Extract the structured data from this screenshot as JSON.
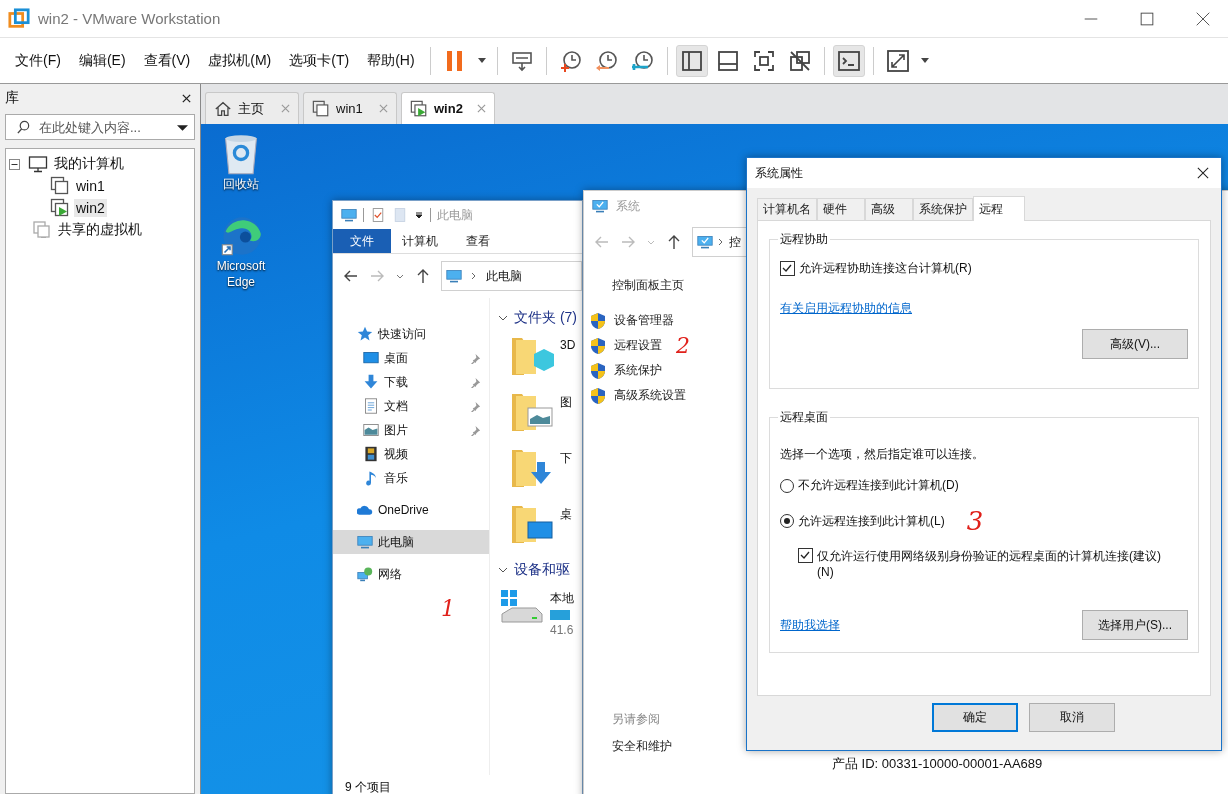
{
  "window": {
    "title": "win2 - VMware Workstation"
  },
  "menu": [
    "文件(F)",
    "编辑(E)",
    "查看(V)",
    "虚拟机(M)",
    "选项卡(T)",
    "帮助(H)"
  ],
  "toolbar": [
    {
      "kind": "pause",
      "pressed": false
    },
    {
      "kind": "caret",
      "pressed": false
    },
    {
      "kind": "sep"
    },
    {
      "kind": "send-keys",
      "pressed": false
    },
    {
      "kind": "sep"
    },
    {
      "kind": "snapshot-take",
      "pressed": false
    },
    {
      "kind": "snapshot-revert",
      "pressed": false
    },
    {
      "kind": "snapshot-manager",
      "pressed": false
    },
    {
      "kind": "sep"
    },
    {
      "kind": "view-library",
      "pressed": true
    },
    {
      "kind": "view-thumbnail",
      "pressed": false
    },
    {
      "kind": "view-fullscreen",
      "pressed": false
    },
    {
      "kind": "view-unity",
      "pressed": false
    },
    {
      "kind": "sep"
    },
    {
      "kind": "console",
      "pressed": true
    },
    {
      "kind": "sep"
    },
    {
      "kind": "stretch",
      "pressed": false
    },
    {
      "kind": "caret",
      "pressed": false
    }
  ],
  "library": {
    "title": "库",
    "search": {
      "placeholder": "在此处键入内容..."
    },
    "tree": [
      {
        "label": "我的计算机",
        "kind": "computer",
        "selected": false,
        "expanded": true,
        "children": [
          {
            "label": "win1",
            "kind": "vm",
            "selected": false
          },
          {
            "label": "win2",
            "kind": "vm-running",
            "selected": true
          }
        ]
      },
      {
        "label": "共享的虚拟机",
        "kind": "shared",
        "selected": false
      }
    ]
  },
  "tabs": [
    {
      "label": "主页",
      "kind": "home",
      "selected": false
    },
    {
      "label": "win1",
      "kind": "vm",
      "selected": false
    },
    {
      "label": "win2",
      "kind": "vm-running",
      "selected": true
    }
  ],
  "desktop": {
    "icons": [
      {
        "label": "回收站",
        "kind": "recycle-bin"
      },
      {
        "label": "Microsoft Edge",
        "kind": "edge"
      }
    ]
  },
  "explorer": {
    "title": "此电脑",
    "ribbon_tabs": [
      {
        "label": "文件",
        "selected": true
      },
      {
        "label": "计算机",
        "selected": false
      },
      {
        "label": "查看",
        "selected": false
      }
    ],
    "address": "此电脑",
    "nav": [
      {
        "label": "快速访问",
        "kind": "star",
        "selected": false,
        "children": [
          {
            "label": "桌面",
            "kind": "desktop",
            "selected": false,
            "pinned": true
          },
          {
            "label": "下载",
            "kind": "download",
            "selected": false,
            "pinned": true
          },
          {
            "label": "文档",
            "kind": "document",
            "selected": false,
            "pinned": true
          },
          {
            "label": "图片",
            "kind": "picture",
            "selected": false,
            "pinned": true
          },
          {
            "label": "视频",
            "kind": "video",
            "selected": false,
            "pinned": false
          },
          {
            "label": "音乐",
            "kind": "music",
            "selected": false,
            "pinned": false
          }
        ]
      },
      {
        "label": "OneDrive",
        "kind": "onedrive",
        "selected": false
      },
      {
        "label": "此电脑",
        "kind": "pc",
        "selected": true
      },
      {
        "label": "网络",
        "kind": "network",
        "selected": false
      }
    ],
    "sections": [
      {
        "title": "文件夹 (7)",
        "items": [
          {
            "label": "3D",
            "kind": "folder-3d"
          },
          {
            "label": "图",
            "kind": "folder-picture"
          },
          {
            "label": "下",
            "kind": "folder-download"
          },
          {
            "label": "桌",
            "kind": "folder-desktop"
          }
        ]
      },
      {
        "title": "设备和驱",
        "items": [
          {
            "label": "本地",
            "detail": "41.6",
            "kind": "drive"
          }
        ]
      }
    ],
    "annotation": "1",
    "status": "9 个项目"
  },
  "system": {
    "title": "系统",
    "address": "控",
    "home_link": "控制面板主页",
    "links": [
      {
        "label": "设备管理器"
      },
      {
        "label": "远程设置",
        "annotation": "2"
      },
      {
        "label": "系统保护"
      },
      {
        "label": "高级系统设置"
      }
    ],
    "see_also": "另请参阅",
    "see_also_links": [
      "安全和维护"
    ],
    "product_id": "产品 ID: 00331-10000-00001-AA689"
  },
  "dialog": {
    "title": "系统属性",
    "tabs": [
      {
        "label": "计算机名",
        "selected": false
      },
      {
        "label": "硬件",
        "selected": false
      },
      {
        "label": "高级",
        "selected": false
      },
      {
        "label": "系统保护",
        "selected": false
      },
      {
        "label": "远程",
        "selected": true
      }
    ],
    "groups": [
      {
        "title": "远程协助",
        "controls": [
          {
            "kind": "checkbox",
            "label": "允许远程协助连接这台计算机(R)",
            "checked": true
          },
          {
            "kind": "link",
            "label": "有关启用远程协助的信息"
          },
          {
            "kind": "button",
            "label": "高级(V)..."
          }
        ]
      },
      {
        "title": "远程桌面",
        "controls": [
          {
            "kind": "text",
            "label": "选择一个选项，然后指定谁可以连接。"
          },
          {
            "kind": "radio",
            "label": "不允许远程连接到此计算机(D)",
            "selected": false
          },
          {
            "kind": "radio",
            "label": "允许远程连接到此计算机(L)",
            "selected": true,
            "annotation": "3"
          },
          {
            "kind": "subcheckbox",
            "label": "仅允许运行使用网络级别身份验证的远程桌面的计算机连接(建议)(N)",
            "checked": true
          },
          {
            "kind": "action-row",
            "link": "帮助我选择",
            "button": "选择用户(S)..."
          }
        ]
      }
    ],
    "buttons": [
      {
        "label": "确定",
        "default": true
      },
      {
        "label": "取消",
        "default": false
      }
    ]
  }
}
